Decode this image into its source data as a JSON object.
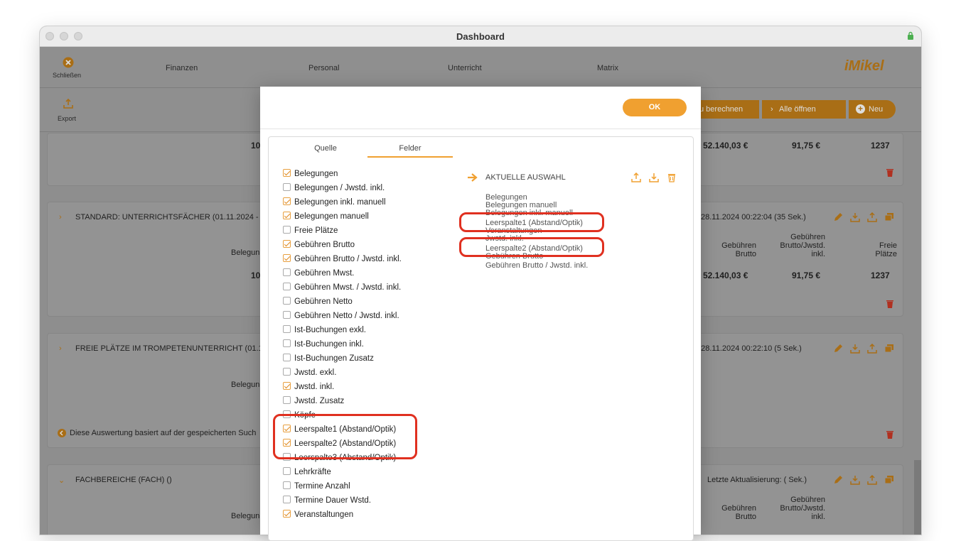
{
  "window": {
    "title": "Dashboard"
  },
  "nav": {
    "close_label": "Schließen",
    "items": [
      "Finanzen",
      "Personal",
      "Unterricht",
      "Matrix"
    ],
    "logo_text": "iMikel"
  },
  "toolbar": {
    "export_label": "Export",
    "recalc_label": "u berechnen",
    "open_all_label": "Alle öffnen",
    "new_label": "Neu"
  },
  "cards": [
    {
      "value_left": "10",
      "value_a": "52.140,03 €",
      "value_b": "91,75 €",
      "value_c": "1237"
    },
    {
      "title": "STANDARD: UNTERRICHTSFÄCHER (01.11.2024 - 3",
      "status": "28.11.2024 00:22:04  (35 Sek.)",
      "col_left": "Belegun",
      "col_h1": "Gebühren",
      "col_h1b": "Brutto",
      "col_h2": "Gebühren",
      "col_h2b": "Brutto/Jwstd.",
      "col_h2c": "inkl.",
      "col_h3": "Freie",
      "col_h3b": "Plätze",
      "value_left": "10",
      "value_a": "52.140,03 €",
      "value_b": "91,75 €",
      "value_c": "1237"
    },
    {
      "title": "FREIE PLÄTZE IM TROMPETENUNTERRICHT (01.11.",
      "status": ": 28.11.2024 00:22:10  (5 Sek.)",
      "col_left": "Belegun",
      "note": "Diese Auswertung basiert auf der gespeicherten Such"
    },
    {
      "title": "FACHBEREICHE (FACH) ()",
      "status": "Letzte Aktualisierung:   ( Sek.)",
      "col_left": "Belegun",
      "col_h1": "Gebühren",
      "col_h1b": "Brutto",
      "col_h2": "Gebühren",
      "col_h2b": "Brutto/Jwstd.",
      "col_h2c": "inkl."
    }
  ],
  "modal": {
    "ok_label": "OK",
    "tabs": [
      "Quelle",
      "Felder"
    ],
    "fields": [
      {
        "label": "Belegungen",
        "checked": true
      },
      {
        "label": "Belegungen / Jwstd. inkl.",
        "checked": false
      },
      {
        "label": "Belegungen inkl. manuell",
        "checked": true
      },
      {
        "label": "Belegungen manuell",
        "checked": true
      },
      {
        "label": "Freie Plätze",
        "checked": false
      },
      {
        "label": "Gebühren Brutto",
        "checked": true
      },
      {
        "label": "Gebühren Brutto / Jwstd. inkl.",
        "checked": true
      },
      {
        "label": "Gebühren Mwst.",
        "checked": false
      },
      {
        "label": "Gebühren Mwst. / Jwstd. inkl.",
        "checked": false
      },
      {
        "label": "Gebühren Netto",
        "checked": false
      },
      {
        "label": "Gebühren Netto / Jwstd. inkl.",
        "checked": false
      },
      {
        "label": "Ist-Buchungen exkl.",
        "checked": false
      },
      {
        "label": "Ist-Buchungen inkl.",
        "checked": false
      },
      {
        "label": "Ist-Buchungen Zusatz",
        "checked": false
      },
      {
        "label": "Jwstd. exkl.",
        "checked": false
      },
      {
        "label": "Jwstd. inkl.",
        "checked": true
      },
      {
        "label": "Jwstd. Zusatz",
        "checked": false
      },
      {
        "label": "Köpfe",
        "checked": false
      },
      {
        "label": "Leerspalte1 (Abstand/Optik)",
        "checked": true
      },
      {
        "label": "Leerspalte2 (Abstand/Optik)",
        "checked": true
      },
      {
        "label": "Leerspalte3 (Abstand/Optik)",
        "checked": false
      },
      {
        "label": "Lehrkräfte",
        "checked": false
      },
      {
        "label": "Termine Anzahl",
        "checked": false
      },
      {
        "label": "Termine Dauer Wstd.",
        "checked": false
      },
      {
        "label": "Veranstaltungen",
        "checked": true
      }
    ],
    "selection_heading": "AKTUELLE AUSWAHL",
    "selection": [
      "Belegungen",
      "Belegungen manuell",
      "Belegungen inkl. manuell",
      "Leerspalte1 (Abstand/Optik)",
      "Veranstaltungen",
      "Jwstd. inkl.",
      "Leerspalte2 (Abstand/Optik)",
      "Gebühren Brutto",
      "Gebühren Brutto / Jwstd. inkl."
    ]
  },
  "colors": {
    "accent": "#f0a030",
    "highlight": "#e03020"
  }
}
